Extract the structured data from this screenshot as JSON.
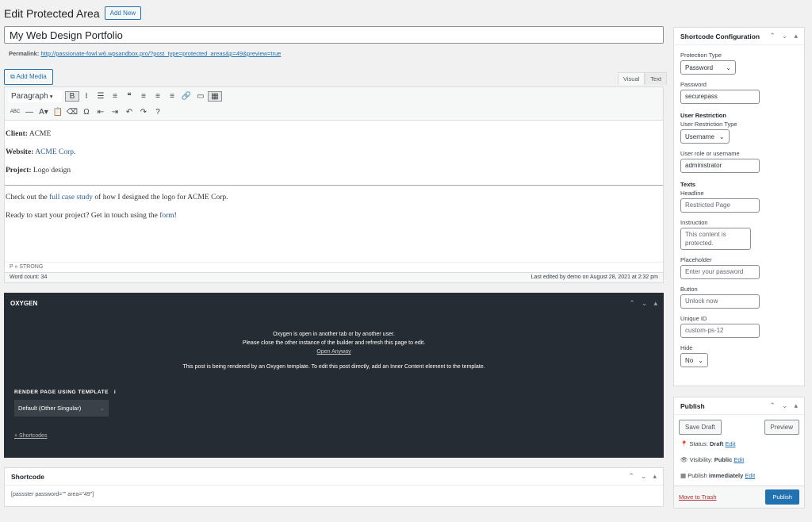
{
  "header": {
    "title": "Edit Protected Area",
    "add_new": "Add New"
  },
  "post": {
    "title": "My Web Design Portfolio",
    "permalink_label": "Permalink:",
    "permalink": "http://passionate-fowl.w6.wpsandbox.pro/?post_type=protected_areas&p=49&preview=true"
  },
  "editor": {
    "add_media": "Add Media",
    "tab_visual": "Visual",
    "tab_text": "Text",
    "format": "Paragraph",
    "toolbar1": [
      {
        "icon": "bold-icon",
        "g": "B"
      },
      {
        "icon": "italic-icon",
        "g": "I"
      },
      {
        "icon": "bullet-list-icon",
        "g": "☰"
      },
      {
        "icon": "numbered-list-icon",
        "g": "≡"
      },
      {
        "icon": "blockquote-icon",
        "g": "❝"
      },
      {
        "icon": "align-left-icon",
        "g": "≡"
      },
      {
        "icon": "align-center-icon",
        "g": "≡"
      },
      {
        "icon": "align-right-icon",
        "g": "≡"
      },
      {
        "icon": "link-icon",
        "g": "🔗"
      },
      {
        "icon": "read-more-icon",
        "g": "▭"
      },
      {
        "icon": "toolbar-toggle-icon",
        "g": "▦"
      }
    ],
    "toolbar2": [
      {
        "icon": "strikethrough-icon",
        "g": "ABC"
      },
      {
        "icon": "horizontal-line-icon",
        "g": "—"
      },
      {
        "icon": "text-color-icon",
        "g": "A▾"
      },
      {
        "icon": "paste-text-icon",
        "g": "📋"
      },
      {
        "icon": "clear-formatting-icon",
        "g": "⌫"
      },
      {
        "icon": "special-character-icon",
        "g": "Ω"
      },
      {
        "icon": "outdent-icon",
        "g": "⇤"
      },
      {
        "icon": "indent-icon",
        "g": "⇥"
      },
      {
        "icon": "undo-icon",
        "g": "↶"
      },
      {
        "icon": "redo-icon",
        "g": "↷"
      },
      {
        "icon": "help-icon",
        "g": "?"
      }
    ],
    "client_label": "Client:",
    "client": "ACME",
    "website_label": "Website:",
    "website": "ACME Corp.",
    "project_label": "Project:",
    "project": "Logo design",
    "p1_a": "Check out the ",
    "p1_link": "full case study",
    "p1_b": " of how I designed the logo for ACME Corp.",
    "p2_a": "Ready to start your project? Get in touch using the ",
    "p2_link": "form",
    "p2_b": "!",
    "path": "P » STRONG",
    "word_count": "Word count: 34",
    "last_edited": "Last edited by demo on August 28, 2021 at 2:32 pm"
  },
  "oxygen": {
    "title": "OXYGEN",
    "msg1": "Oxygen is open in another tab or by another user.",
    "msg2": "Please close the other instance of the builder and refresh this page to edit.",
    "open_anyway": "Open Anyway",
    "msg3": "This post is being rendered by an Oxygen template. To edit this post directly, add an Inner Content element to the template.",
    "render_label": "RENDER PAGE USING TEMPLATE",
    "render_info": "i",
    "template": "Default (Other Singular)",
    "shortcodes": "+ Shortcodes"
  },
  "shortcode": {
    "title": "Shortcode",
    "value": "[passster password=\"\" area=\"49\"]"
  },
  "config": {
    "title": "Shortcode Configuration",
    "protection_type_label": "Protection Type",
    "protection_type": "Password",
    "password_label": "Password",
    "password": "securepass",
    "user_restriction": "User Restriction",
    "restriction_type_label": "User Restriction Type",
    "restriction_type": "Username",
    "user_label": "User role or username",
    "user": "administrator",
    "texts": "Texts",
    "headline_label": "Headline",
    "headline": "Restricted Page",
    "instruction_label": "Instruction",
    "instruction": "This content is protected.",
    "placeholder_label": "Placeholder",
    "placeholder": "Enter your password",
    "button_label": "Button",
    "button": "Unlock now",
    "uid_label": "Unique ID",
    "uid": "custom-ps-12",
    "hide_label": "Hide",
    "hide": "No"
  },
  "publish": {
    "title": "Publish",
    "save_draft": "Save Draft",
    "preview": "Preview",
    "status_label": "Status:",
    "status": "Draft",
    "visibility_label": "Visibility:",
    "visibility": "Public",
    "publish_label": "Publish",
    "publish_when": "immediately",
    "edit": "Edit",
    "trash": "Move to Trash",
    "publish_btn": "Publish"
  },
  "colors": {
    "accent": "#2271b1",
    "oxygen_bg": "#262c33"
  }
}
